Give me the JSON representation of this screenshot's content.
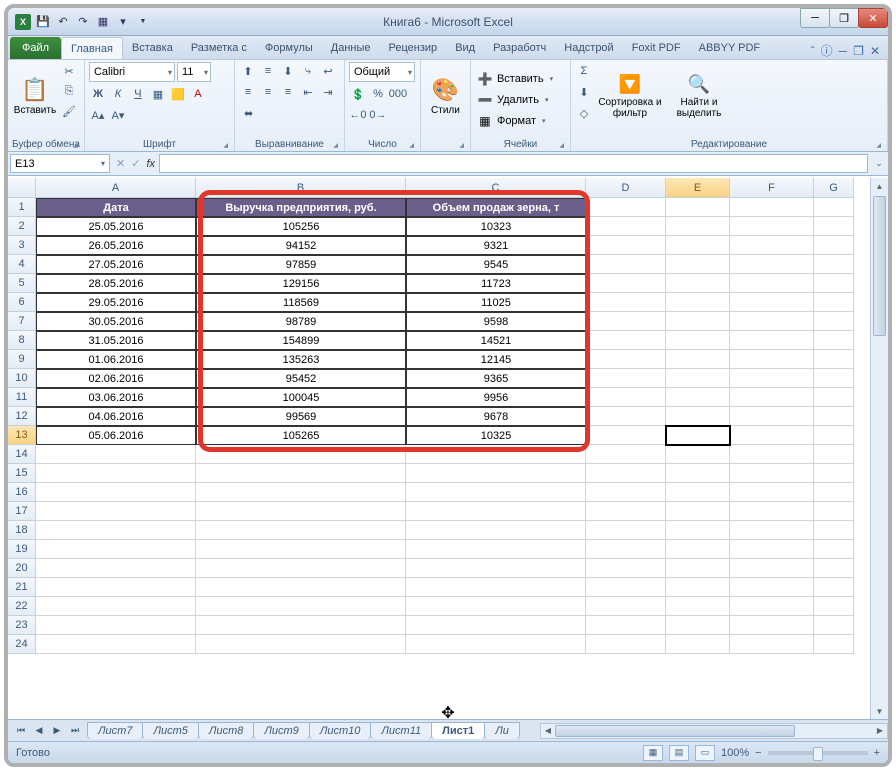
{
  "title": "Книга6 - Microsoft Excel",
  "qat_items": [
    "save",
    "undo",
    "redo",
    "print",
    "open"
  ],
  "tabs": {
    "file": "Файл",
    "list": [
      "Главная",
      "Вставка",
      "Разметка с",
      "Формулы",
      "Данные",
      "Рецензир",
      "Вид",
      "Разработч",
      "Надстрой",
      "Foxit PDF",
      "ABBYY PDF"
    ],
    "active": 0
  },
  "ribbon": {
    "clipboard": {
      "paste": "Вставить",
      "label": "Буфер обмена"
    },
    "font": {
      "name": "Calibri",
      "size": "11",
      "label": "Шрифт"
    },
    "align": {
      "label": "Выравнивание"
    },
    "number": {
      "format": "Общий",
      "label": "Число"
    },
    "styles": {
      "btn": "Стили",
      "label": ""
    },
    "cells": {
      "insert": "Вставить",
      "delete": "Удалить",
      "format": "Формат",
      "label": "Ячейки"
    },
    "editing": {
      "sort": "Сортировка и фильтр",
      "find": "Найти и выделить",
      "label": "Редактирование"
    }
  },
  "namebox": "E13",
  "columns": [
    "A",
    "B",
    "C",
    "D",
    "E",
    "F",
    "G"
  ],
  "selected_col_index": 4,
  "headers": [
    "Дата",
    "Выручка предприятия, руб.",
    "Объем продаж зерна, т"
  ],
  "rows": [
    {
      "n": 1
    },
    {
      "n": 2,
      "a": "25.05.2016",
      "b": "105256",
      "c": "10323"
    },
    {
      "n": 3,
      "a": "26.05.2016",
      "b": "94152",
      "c": "9321"
    },
    {
      "n": 4,
      "a": "27.05.2016",
      "b": "97859",
      "c": "9545"
    },
    {
      "n": 5,
      "a": "28.05.2016",
      "b": "129156",
      "c": "11723"
    },
    {
      "n": 6,
      "a": "29.05.2016",
      "b": "118569",
      "c": "11025"
    },
    {
      "n": 7,
      "a": "30.05.2016",
      "b": "98789",
      "c": "9598"
    },
    {
      "n": 8,
      "a": "31.05.2016",
      "b": "154899",
      "c": "14521"
    },
    {
      "n": 9,
      "a": "01.06.2016",
      "b": "135263",
      "c": "12145"
    },
    {
      "n": 10,
      "a": "02.06.2016",
      "b": "95452",
      "c": "9365"
    },
    {
      "n": 11,
      "a": "03.06.2016",
      "b": "100045",
      "c": "9956"
    },
    {
      "n": 12,
      "a": "04.06.2016",
      "b": "99569",
      "c": "9678"
    },
    {
      "n": 13,
      "a": "05.06.2016",
      "b": "105265",
      "c": "10325",
      "sel": true
    }
  ],
  "empty_rows": [
    14,
    15,
    16,
    17,
    18,
    19,
    20,
    21,
    22,
    23,
    24
  ],
  "sheets": [
    "Лист7",
    "Лист5",
    "Лист8",
    "Лист9",
    "Лист10",
    "Лист11",
    "Лист1",
    "Ли"
  ],
  "active_sheet": 6,
  "status": {
    "ready": "Готово",
    "zoom": "100%"
  },
  "icons": {
    "minus": "─",
    "restore": "❐",
    "close": "✕",
    "help": "?",
    "up": "▴",
    "cut": "✂",
    "copy": "📄",
    "brush": "🖌",
    "bold": "Ж",
    "italic": "К",
    "underline": "Ч",
    "sigma": "Σ",
    "fill": "⬇",
    "clear": "◇"
  }
}
